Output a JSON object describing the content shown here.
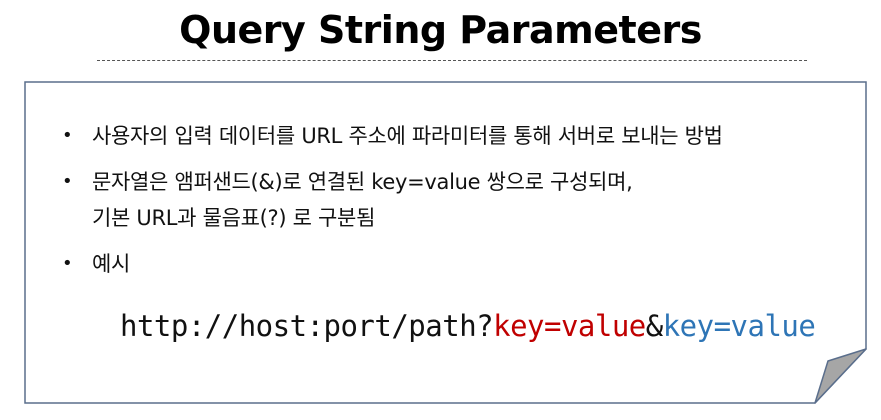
{
  "title": "Query String Parameters",
  "bullets": [
    {
      "lines": [
        "사용자의 입력 데이터를 URL 주소에 파라미터를 통해 서버로 보내는 방법"
      ]
    },
    {
      "lines": [
        "문자열은 앰퍼샌드(&)로 연결된 key=value 쌍으로 구성되며,",
        "기본 URL과 물음표(?) 로 구분됨"
      ]
    },
    {
      "lines": [
        "예시"
      ]
    }
  ],
  "bullet_symbol": "•",
  "example": {
    "prefix": "http://host:port/path?",
    "key_value_1": "key=value",
    "separator": "&",
    "key_value_2": "key=value"
  },
  "colors": {
    "key_value_1": "#c00000",
    "key_value_2": "#2e75b6",
    "card_border": "#5a6e8c",
    "card_fold": "#a6a6a6"
  }
}
